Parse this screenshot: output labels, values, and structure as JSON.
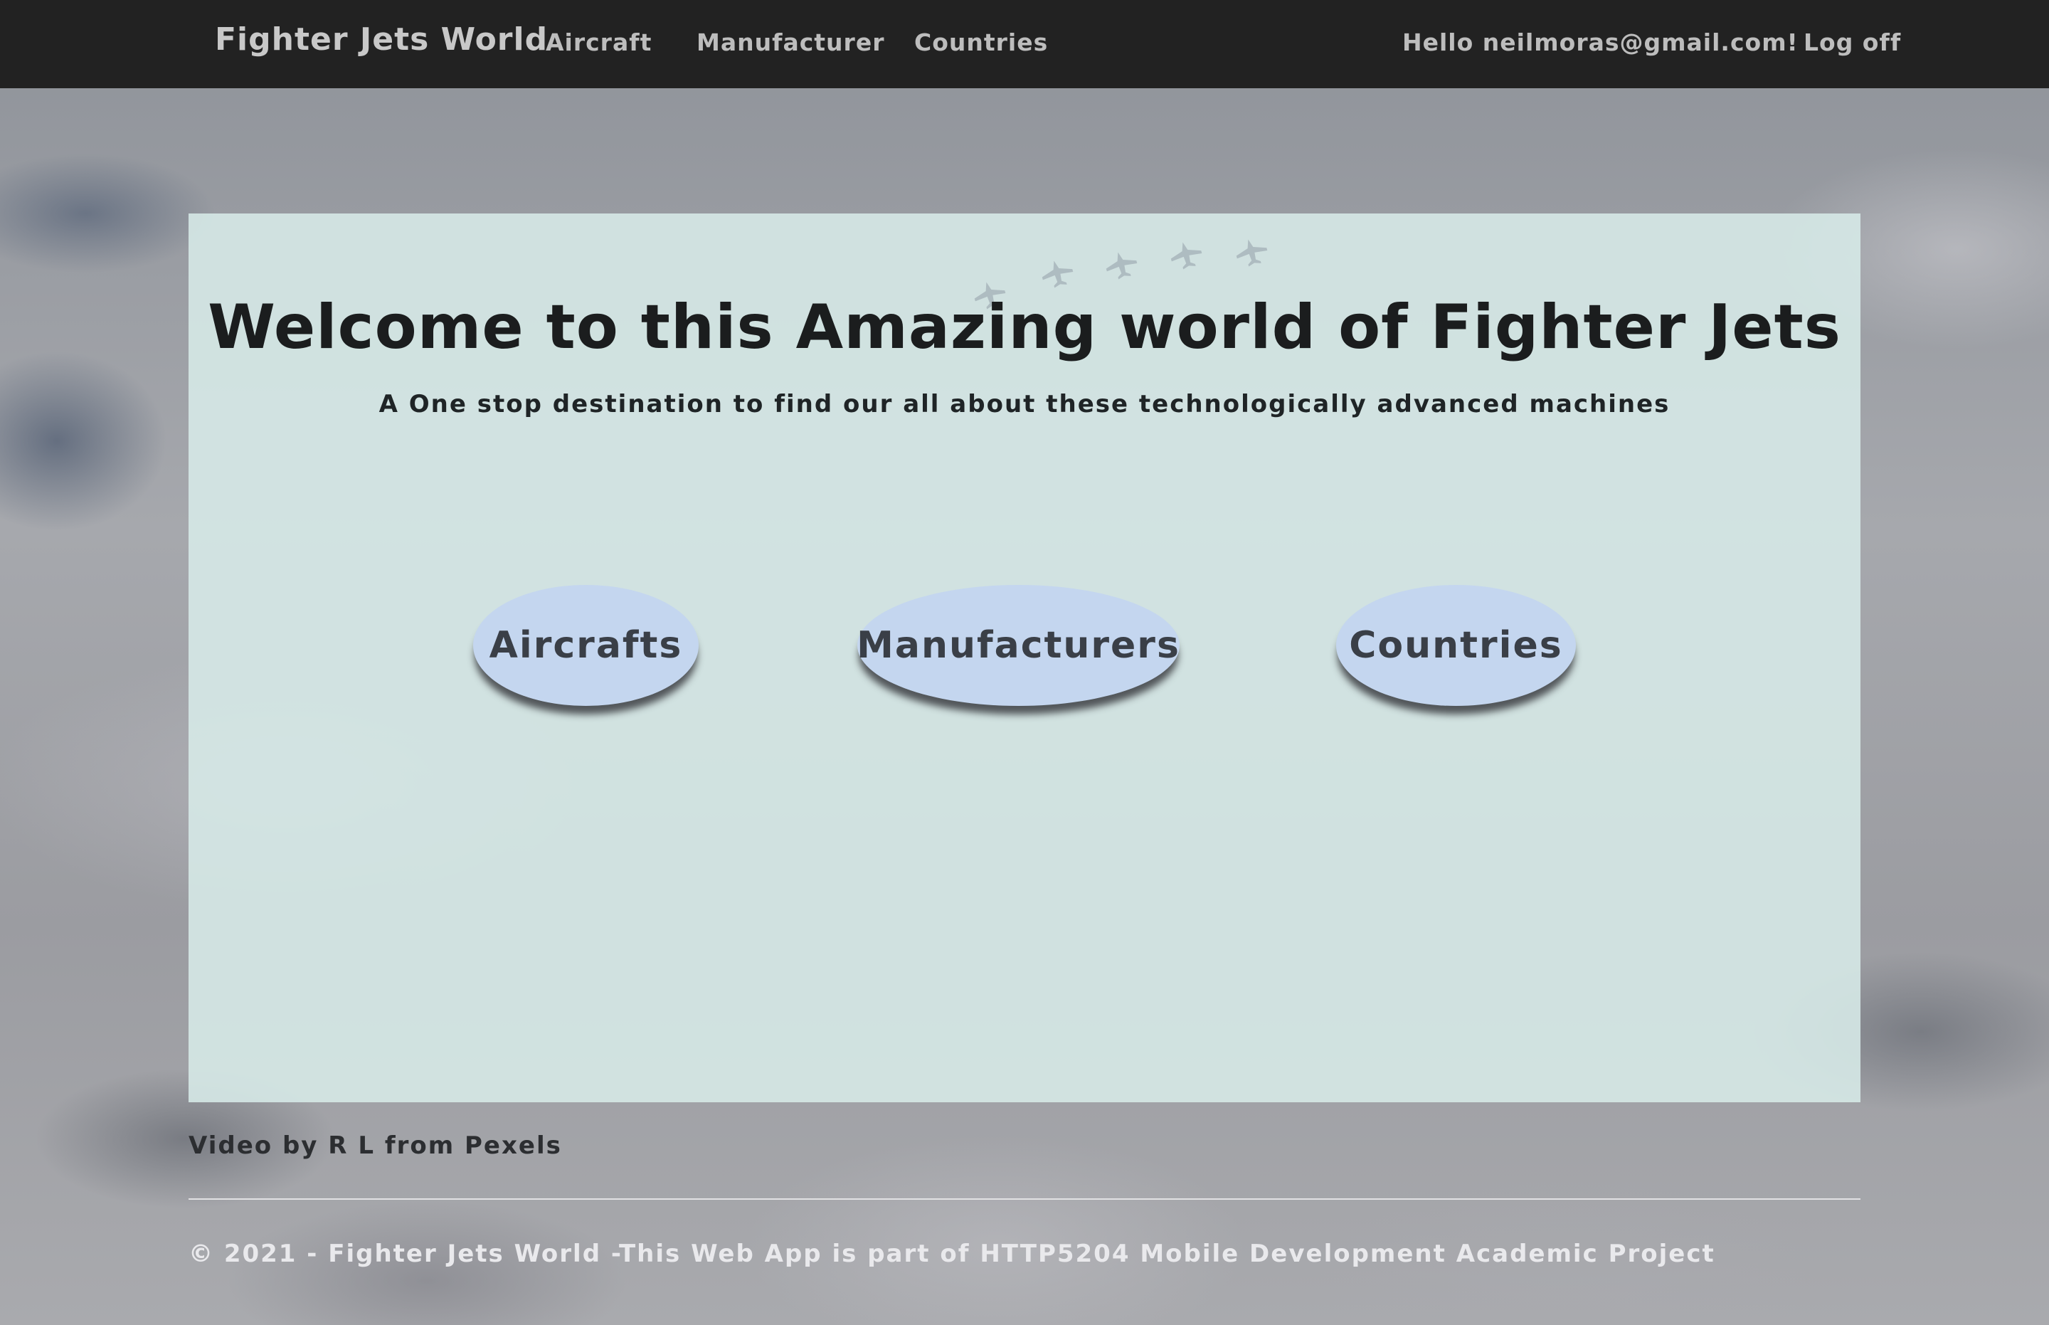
{
  "navbar": {
    "brand": "Fighter Jets World",
    "links": {
      "aircraft": "Aircraft",
      "manufacturer": "Manufacturer",
      "countries": "Countries"
    },
    "greeting": "Hello neilmoras@gmail.com!",
    "logoff": "Log off"
  },
  "main": {
    "title": "Welcome to this Amazing world of Fighter Jets",
    "subtitle": "A One stop destination to find our all about these technologically advanced machines",
    "buttons": {
      "aircrafts": "Aircrafts",
      "manufacturers": "Manufacturers",
      "countries": "Countries"
    },
    "decoration_icon": "jet-formation-icon"
  },
  "credit": "Video by R L from Pexels",
  "footer": "© 2021 - Fighter Jets World -This Web App is part of HTTP5204 Mobile Development Academic Project",
  "colors": {
    "navbar_bg": "#222222",
    "panel_bg": "#d7eae8",
    "button_bg": "#c4d6ef",
    "title_text": "#1b1d1e"
  }
}
